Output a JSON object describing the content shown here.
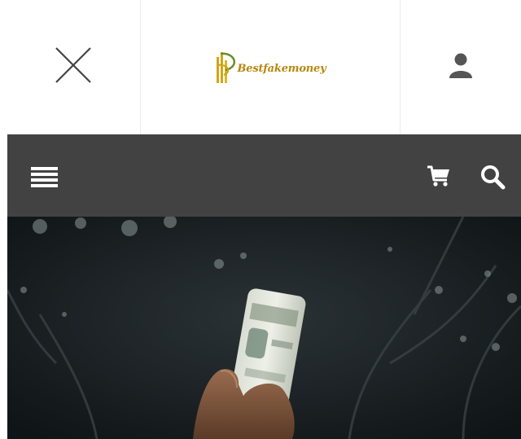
{
  "header": {
    "close_icon": "close-icon",
    "logo_text": "Bestfakemoney",
    "user_icon": "user-icon"
  },
  "navbar": {
    "menu_icon": "hamburger-menu-icon",
    "cart_icon": "cart-icon",
    "search_icon": "search-icon"
  },
  "hero": {
    "image": "hand-holding-rolled-dollar-bills"
  },
  "colors": {
    "navbar_bg": "#424242",
    "logo_gold": "#d4a514",
    "icon_gray": "#555555"
  }
}
